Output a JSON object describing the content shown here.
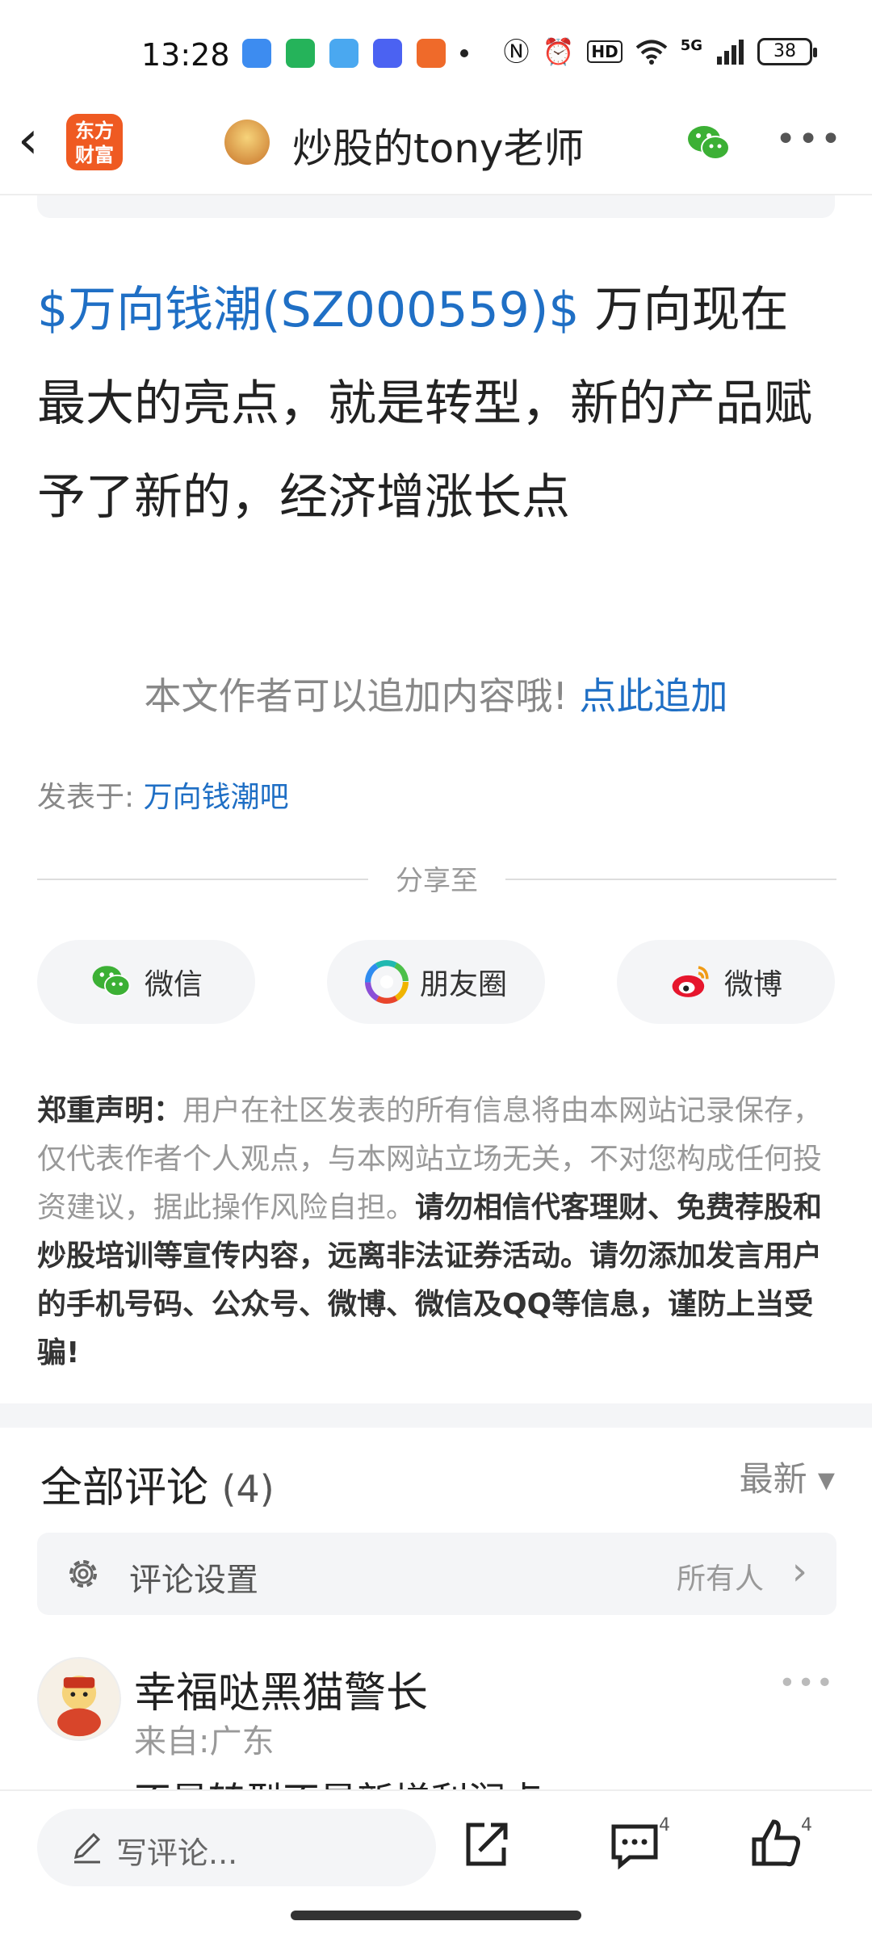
{
  "status_bar": {
    "time": "13:28",
    "network": "5G",
    "battery": "38"
  },
  "nav": {
    "logo_text": "东方\n财富",
    "title": "炒股的tony老师"
  },
  "post": {
    "stock_link": "$万向钱潮(SZ000559)$",
    "body": " 万向现在最大的亮点，就是转型，新的产品赋予了新的，经济增涨长点"
  },
  "append": {
    "text": "本文作者可以追加内容哦! ",
    "link": "点此追加"
  },
  "posted_in": {
    "label": "发表于: ",
    "bar": "万向钱潮吧"
  },
  "share": {
    "label": "分享至",
    "buttons": [
      {
        "label": "微信",
        "icon": "wechat-icon"
      },
      {
        "label": "朋友圈",
        "icon": "moments-icon"
      },
      {
        "label": "微博",
        "icon": "weibo-icon"
      }
    ]
  },
  "disclaimer": {
    "title": "郑重声明：",
    "normal": "用户在社区发表的所有信息将由本网站记录保存，仅代表作者个人观点，与本网站立场无关，不对您构成任何投资建议，据此操作风险自担。",
    "bold": "请勿相信代客理财、免费荐股和炒股培训等宣传内容，远离非法证券活动。请勿添加发言用户的手机号码、公众号、微博、微信及QQ等信息，谨防上当受骗!"
  },
  "comments": {
    "title": "全部评论",
    "count": "(4)",
    "sort": "最新 ▾",
    "settings_label": "评论设置",
    "settings_value": "所有人",
    "items": [
      {
        "user": "幸福哒黑猫警长",
        "location": "来自:广东",
        "text": "不是转型不是新增利润点"
      }
    ]
  },
  "bottom_bar": {
    "placeholder": "写评论...",
    "comment_count": "4",
    "like_count": "4"
  },
  "colors": {
    "link": "#1f6fc5",
    "brand": "#ef5a22",
    "wechat": "#3cb035"
  }
}
